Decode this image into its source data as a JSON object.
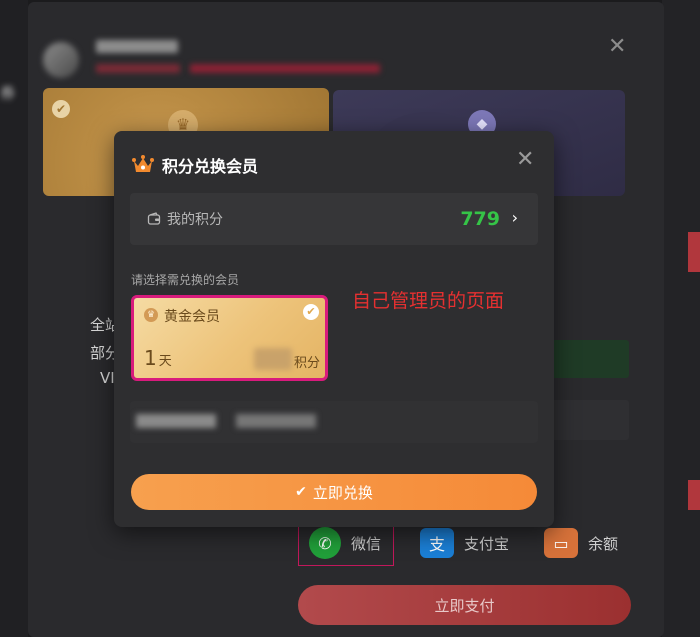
{
  "background_page": {
    "left_fragments": [
      "券"
    ],
    "middle_fragments": [
      "全站",
      "部分",
      "VI"
    ]
  },
  "payment_dialog": {
    "close_icon": "close-icon",
    "plans": [
      {
        "name": "gold-plan",
        "selected": true
      },
      {
        "name": "diamond-plan",
        "selected": false
      }
    ],
    "pay_methods": [
      {
        "label": "微信",
        "icon": "wechat-icon",
        "selected": true
      },
      {
        "label": "支付宝",
        "icon": "alipay-icon",
        "selected": false
      },
      {
        "label": "余额",
        "icon": "wallet-icon",
        "selected": false
      }
    ],
    "pay_button": "立即支付"
  },
  "modal": {
    "title": "积分兑换会员",
    "points_label": "我的积分",
    "points_value": "779",
    "select_hint": "请选择需兑换的会员",
    "card": {
      "name": "黄金会员",
      "days": "1",
      "days_unit": "天",
      "price_unit": "积分",
      "selected": true
    },
    "annotation": "自己管理员的页面",
    "redeem_button": "立即兑换",
    "colors": {
      "accent_orange": "#f58a38",
      "points_green": "#35c447",
      "selected_border": "#d81b7c",
      "annotation_red": "#e53030"
    }
  }
}
